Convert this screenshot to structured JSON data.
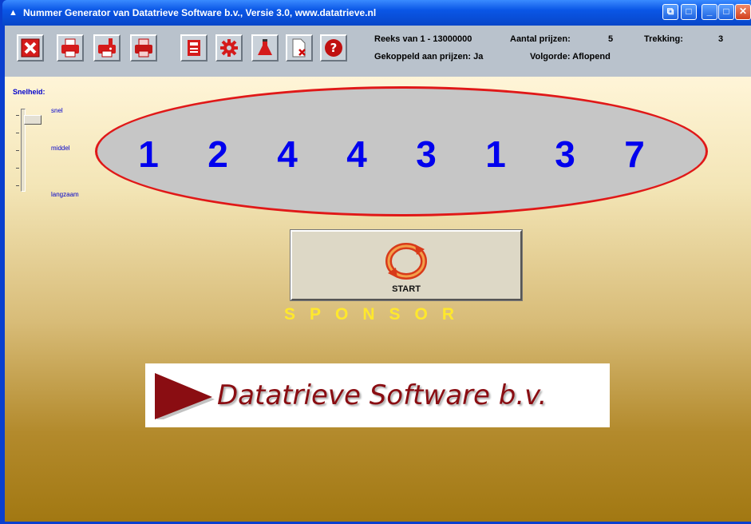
{
  "window": {
    "title": "Nummer Generator van Datatrieve Software b.v., Versie 3.0, www.datatrieve.nl",
    "app_icon": "app-icon"
  },
  "toolbar": {
    "buttons": [
      {
        "name": "exit",
        "icon": "close-icon"
      },
      {
        "name": "print",
        "icon": "printer-icon"
      },
      {
        "name": "print-warning",
        "icon": "printer-alert-icon"
      },
      {
        "name": "print-list",
        "icon": "printer-red-icon"
      },
      {
        "name": "calculator",
        "icon": "calculator-icon"
      },
      {
        "name": "settings",
        "icon": "gear-icon"
      },
      {
        "name": "lottery",
        "icon": "flask-icon"
      },
      {
        "name": "delete-file",
        "icon": "file-delete-icon"
      },
      {
        "name": "help",
        "icon": "help-icon"
      }
    ]
  },
  "info": {
    "range": "Reeks van 1 - 13000000",
    "prizes_label": "Aantal prijzen:",
    "prizes_value": "5",
    "draw_label": "Trekking:",
    "draw_value": "3",
    "linked": "Gekoppeld aan prijzen: Ja",
    "order": "Volgorde: Aflopend"
  },
  "speed": {
    "title": "Snelheid:",
    "fast": "snel",
    "medium": "middel",
    "slow": "langzaam",
    "level": 0.1
  },
  "digits": [
    "1",
    "2",
    "4",
    "4",
    "3",
    "1",
    "3",
    "7"
  ],
  "start_label": "START",
  "sponsor_label": "SPONSOR",
  "logo_text": "Datatrieve Software b.v.",
  "colors": {
    "digit": "#0000ee",
    "ellipse_border": "#e01818",
    "sponsor": "#ffe82c",
    "logo": "#8a0d12"
  }
}
